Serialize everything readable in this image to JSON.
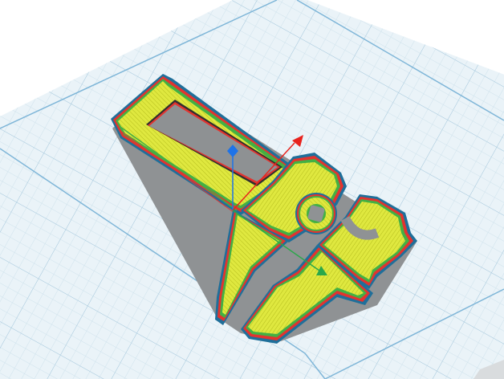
{
  "viewport": {
    "background": "#ffffff",
    "build_plate": {
      "color": "#e8f1f6",
      "grid_color": "#bcd7e6",
      "edge_color": "#7fb6d8"
    }
  },
  "model": {
    "perimeter_colors": [
      "#1f6f9a",
      "#e3332f",
      "#43b044"
    ],
    "infill_color": "#dbe63b",
    "shadow_color": "#8f9294"
  },
  "gizmo": {
    "axes": [
      {
        "name": "z",
        "color": "#1e73e8",
        "icon": "diamond-handle"
      },
      {
        "name": "x",
        "color": "#e8231d",
        "icon": "arrow-handle"
      },
      {
        "name": "y",
        "color": "#2aa84a",
        "icon": "arrow-handle"
      }
    ]
  }
}
